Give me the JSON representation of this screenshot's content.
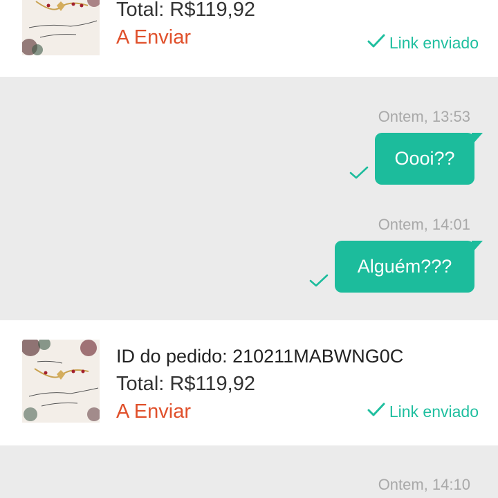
{
  "orders": [
    {
      "total": "Total: R$119,92",
      "status": "A Enviar",
      "link_status": "Link enviado"
    },
    {
      "id": "ID do pedido: 210211MABWNG0C",
      "total": "Total: R$119,92",
      "status": "A Enviar",
      "link_status": "Link enviado"
    }
  ],
  "messages": [
    {
      "timestamp": "Ontem, 13:53",
      "text": "Oooi??"
    },
    {
      "timestamp": "Ontem, 14:01",
      "text": "Alguém???"
    }
  ],
  "next_timestamp": "Ontem, 14:10",
  "colors": {
    "accent": "#1cbc9c",
    "status": "#e0502b",
    "timestamp": "#a9a9a9"
  },
  "icons": [
    "product-thumbnail",
    "checkmark-icon",
    "sent-check-icon"
  ]
}
